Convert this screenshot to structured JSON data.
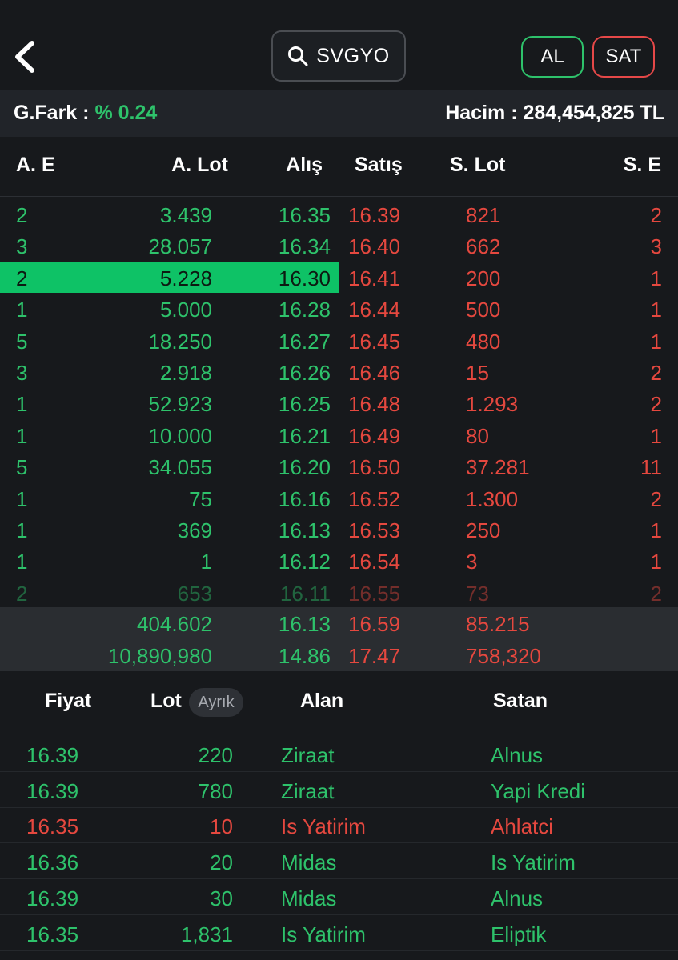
{
  "header": {
    "search_text": "SVGYO",
    "buy_label": "AL",
    "sell_label": "SAT"
  },
  "info": {
    "gfark_label": "G.Fark :",
    "gfark_value": "% 0.24",
    "hacim_text": "Hacim : 284,454,825 TL"
  },
  "columns": {
    "ae": "A. E",
    "alot": "A. Lot",
    "alis": "Alış",
    "satis": "Satış",
    "slot": "S. Lot",
    "se": "S. E"
  },
  "orderbook": [
    {
      "ae": "2",
      "alot": "3.439",
      "alis": "16.35",
      "satis": "16.39",
      "slot": "821",
      "se": "2"
    },
    {
      "ae": "3",
      "alot": "28.057",
      "alis": "16.34",
      "satis": "16.40",
      "slot": "662",
      "se": "3"
    },
    {
      "ae": "2",
      "alot": "5.228",
      "alis": "16.30",
      "satis": "16.41",
      "slot": "200",
      "se": "1"
    },
    {
      "ae": "1",
      "alot": "5.000",
      "alis": "16.28",
      "satis": "16.44",
      "slot": "500",
      "se": "1"
    },
    {
      "ae": "5",
      "alot": "18.250",
      "alis": "16.27",
      "satis": "16.45",
      "slot": "480",
      "se": "1"
    },
    {
      "ae": "3",
      "alot": "2.918",
      "alis": "16.26",
      "satis": "16.46",
      "slot": "15",
      "se": "2"
    },
    {
      "ae": "1",
      "alot": "52.923",
      "alis": "16.25",
      "satis": "16.48",
      "slot": "1.293",
      "se": "2"
    },
    {
      "ae": "1",
      "alot": "10.000",
      "alis": "16.21",
      "satis": "16.49",
      "slot": "80",
      "se": "1"
    },
    {
      "ae": "5",
      "alot": "34.055",
      "alis": "16.20",
      "satis": "16.50",
      "slot": "37.281",
      "se": "11"
    },
    {
      "ae": "1",
      "alot": "75",
      "alis": "16.16",
      "satis": "16.52",
      "slot": "1.300",
      "se": "2"
    },
    {
      "ae": "1",
      "alot": "369",
      "alis": "16.13",
      "satis": "16.53",
      "slot": "250",
      "se": "1"
    },
    {
      "ae": "1",
      "alot": "1",
      "alis": "16.12",
      "satis": "16.54",
      "slot": "3",
      "se": "1"
    },
    {
      "ae": "2",
      "alot": "653",
      "alis": "16.11",
      "satis": "16.55",
      "slot": "73",
      "se": "2"
    }
  ],
  "totals": [
    {
      "alot": "404.602",
      "alis": "16.13",
      "satis": "16.59",
      "slot": "85.215"
    },
    {
      "alot": "10,890,980",
      "alis": "14.86",
      "satis": "17.47",
      "slot": "758,320"
    }
  ],
  "trades_header": {
    "fiyat": "Fiyat",
    "lot": "Lot",
    "ayrik": "Ayrık",
    "alan": "Alan",
    "satan": "Satan"
  },
  "trades": [
    {
      "fiyat": "16.39",
      "lot": "220",
      "alan": "Ziraat",
      "satan": "Alnus",
      "side": "buy"
    },
    {
      "fiyat": "16.39",
      "lot": "780",
      "alan": "Ziraat",
      "satan": "Yapi Kredi",
      "side": "buy"
    },
    {
      "fiyat": "16.35",
      "lot": "10",
      "alan": "Is Yatirim",
      "satan": "Ahlatci",
      "side": "sell"
    },
    {
      "fiyat": "16.36",
      "lot": "20",
      "alan": "Midas",
      "satan": "Is Yatirim",
      "side": "buy"
    },
    {
      "fiyat": "16.39",
      "lot": "30",
      "alan": "Midas",
      "satan": "Alnus",
      "side": "buy"
    },
    {
      "fiyat": "16.35",
      "lot": "1,831",
      "alan": "Is Yatirim",
      "satan": "Eliptik",
      "side": "buy"
    }
  ],
  "colors": {
    "buy": "#2ec26b",
    "sell": "#e5483f",
    "highlight": "#0ec266",
    "background": "#17191c"
  }
}
